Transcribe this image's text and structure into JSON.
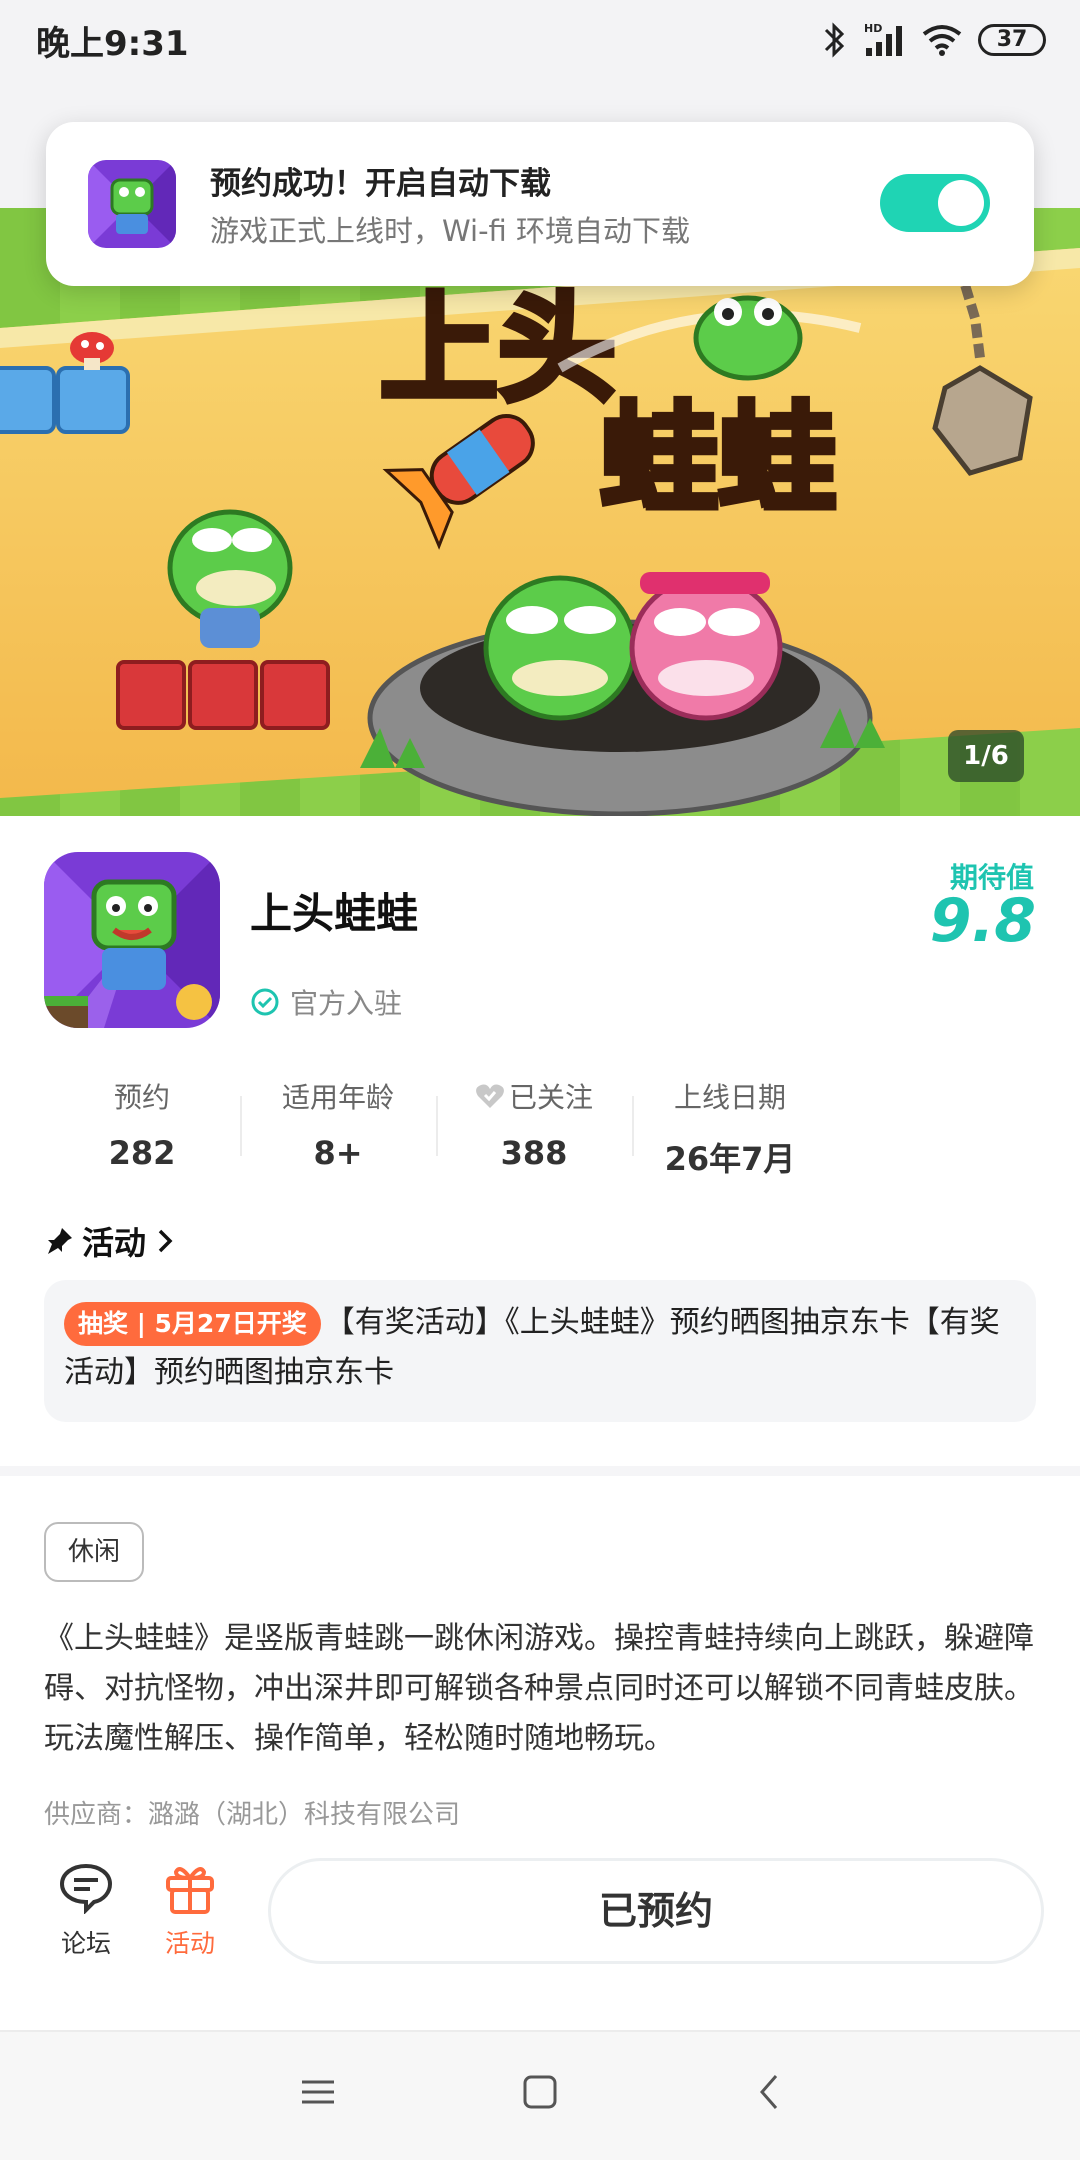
{
  "status_bar": {
    "time": "晚上9:31",
    "network": "HD",
    "battery": "37"
  },
  "notification": {
    "title": "预约成功！开启自动下载",
    "subtitle": "游戏正式上线时，Wi-fi 环境自动下载",
    "auto_download_enabled": true
  },
  "banner": {
    "logo_text": "上头蛙蛙",
    "pager": "1/6"
  },
  "app": {
    "name": "上头蛙蛙",
    "official_label": "官方入驻",
    "expect_label": "期待值",
    "expect_value": "9.8"
  },
  "stats": [
    {
      "label": "预约",
      "value": "282"
    },
    {
      "label": "适用年龄",
      "value": "8+"
    },
    {
      "label": "已关注",
      "value": "388"
    },
    {
      "label": "上线日期",
      "value": "26年7月"
    }
  ],
  "activity": {
    "heading": "活动",
    "pill": "抽奖 | 5月27日开奖",
    "text": "【有奖活动】《上头蛙蛙》预约晒图抽京东卡【有奖活动】预约晒图抽京东卡"
  },
  "tag": "休闲",
  "description": "《上头蛙蛙》是竖版青蛙跳一跳休闲游戏。操控青蛙持续向上跳跃，躲避障碍、对抗怪物，冲出深井即可解锁各种景点同时还可以解锁不同青蛙皮肤。玩法魔性解压、操作简单，轻松随时随地畅玩。",
  "supplier": "供应商：潞潞（湖北）科技有限公司",
  "bottom": {
    "forum_label": "论坛",
    "activity_label": "活动",
    "reserved_label": "已预约"
  },
  "colors": {
    "accent": "#1ec4b0",
    "orange": "#ff6b3d",
    "toggle": "#1fd4b4"
  }
}
